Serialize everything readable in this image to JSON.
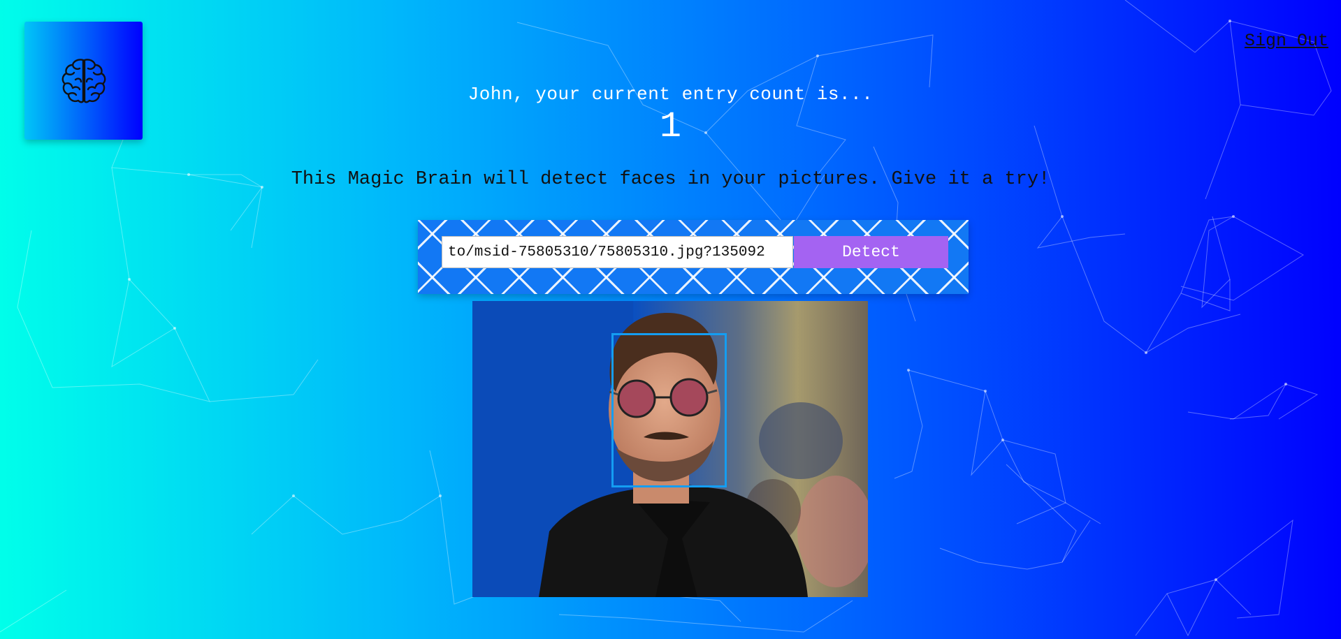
{
  "header": {
    "signout_label": "Sign Out",
    "logo_icon": "brain-icon"
  },
  "rank": {
    "message": "John, your current entry count is...",
    "count": "1"
  },
  "intro": {
    "tagline": "This Magic Brain will detect faces in your pictures. Give it a try!"
  },
  "form": {
    "url_value": "to/msid-75805310/75805310.jpg?135092",
    "detect_label": "Detect"
  },
  "result": {
    "image_icon": "portrait-photo",
    "face_count": 1
  },
  "colors": {
    "background_start": "#00ffea",
    "background_end": "#0000fe",
    "button": "#a463f2",
    "face_box": "#149df2"
  }
}
